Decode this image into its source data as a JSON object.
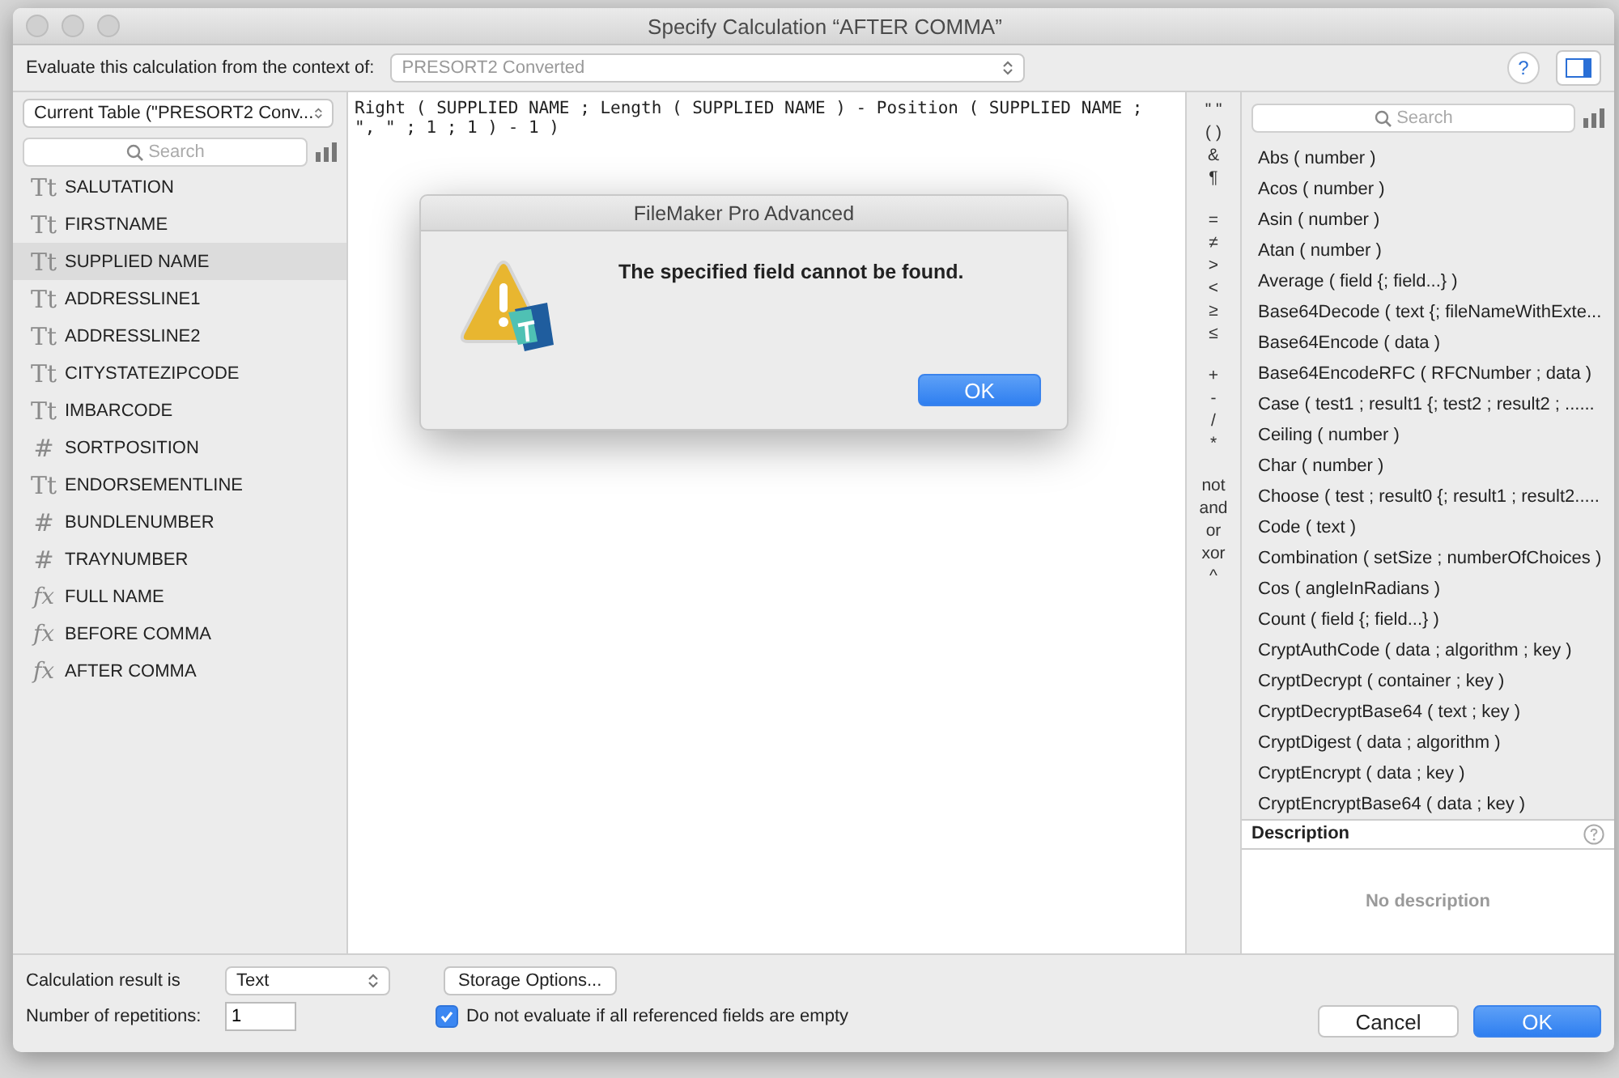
{
  "window": {
    "title": "Specify Calculation “AFTER COMMA”"
  },
  "help_button": "?",
  "context": {
    "label": "Evaluate this calculation from the context of:",
    "value": "PRESORT2 Converted",
    "disabled": true
  },
  "fields_panel": {
    "table_select": "Current Table (\"PRESORT2 Conv...",
    "search": {
      "placeholder": "Search"
    },
    "items": [
      {
        "kind": "text",
        "icon": "Tt",
        "name": "SALUTATION",
        "selected": false
      },
      {
        "kind": "text",
        "icon": "Tt",
        "name": "FIRSTNAME",
        "selected": false
      },
      {
        "kind": "text",
        "icon": "Tt",
        "name": "SUPPLIED NAME",
        "selected": true
      },
      {
        "kind": "text",
        "icon": "Tt",
        "name": "ADDRESSLINE1",
        "selected": false
      },
      {
        "kind": "text",
        "icon": "Tt",
        "name": "ADDRESSLINE2",
        "selected": false
      },
      {
        "kind": "text",
        "icon": "Tt",
        "name": "CITYSTATEZIPCODE",
        "selected": false
      },
      {
        "kind": "text",
        "icon": "Tt",
        "name": "IMBARCODE",
        "selected": false
      },
      {
        "kind": "number",
        "icon": "#",
        "name": "SORTPOSITION",
        "selected": false
      },
      {
        "kind": "text",
        "icon": "Tt",
        "name": "ENDORSEMENTLINE",
        "selected": false
      },
      {
        "kind": "number",
        "icon": "#",
        "name": "BUNDLENUMBER",
        "selected": false
      },
      {
        "kind": "number",
        "icon": "#",
        "name": "TRAYNUMBER",
        "selected": false
      },
      {
        "kind": "calc",
        "icon": "fx",
        "name": "FULL NAME",
        "selected": false
      },
      {
        "kind": "calc",
        "icon": "fx",
        "name": "BEFORE COMMA",
        "selected": false
      },
      {
        "kind": "calc",
        "icon": "fx",
        "name": "AFTER COMMA",
        "selected": false
      }
    ]
  },
  "formula": [
    "Right ( SUPPLIED NAME ; Length ( SUPPLIED NAME ) - Position ( SUPPLIED NAME ;",
    "\", \" ; 1 ; 1 ) - 1 )"
  ],
  "operators": [
    [
      "\" \"",
      "( )",
      "&",
      "¶"
    ],
    [
      "=",
      "≠",
      ">",
      "<",
      "≥",
      "≤"
    ],
    [
      "+",
      "-",
      "/",
      "*"
    ],
    [
      "not",
      "and",
      "or",
      "xor",
      "^"
    ]
  ],
  "functions_panel": {
    "search": {
      "placeholder": "Search"
    },
    "items": [
      "Abs ( number )",
      "Acos ( number )",
      "Asin ( number )",
      "Atan ( number )",
      "Average ( field {; field...} )",
      "Base64Decode ( text {; fileNameWithExte...",
      "Base64Encode ( data )",
      "Base64EncodeRFC ( RFCNumber ; data )",
      "Case ( test1 ; result1 {; test2 ; result2 ; ......",
      "Ceiling ( number )",
      "Char ( number )",
      "Choose ( test ; result0 {; result1 ; result2.....",
      "Code ( text )",
      "Combination ( setSize ; numberOfChoices )",
      "Cos ( angleInRadians )",
      "Count ( field {; field...} )",
      "CryptAuthCode ( data ; algorithm ; key )",
      "CryptDecrypt ( container ; key )",
      "CryptDecryptBase64 ( text ; key )",
      "CryptDigest ( data ; algorithm )",
      "CryptEncrypt ( data ; key )",
      "CryptEncryptBase64 ( data ; key )"
    ],
    "description": {
      "title": "Description",
      "text": "No description"
    }
  },
  "result": {
    "label": "Calculation result is",
    "value": "Text",
    "storage_button": "Storage Options..."
  },
  "repetitions": {
    "label": "Number of repetitions:",
    "value": "1"
  },
  "do_not_evaluate": {
    "label": "Do not evaluate if all referenced fields are empty",
    "checked": true
  },
  "buttons": [
    {
      "label": "Cancel",
      "default": false
    },
    {
      "label": "OK",
      "default": true
    }
  ],
  "alert": {
    "title": "FileMaker Pro Advanced",
    "message": "The specified field cannot be found.",
    "button": "OK"
  }
}
